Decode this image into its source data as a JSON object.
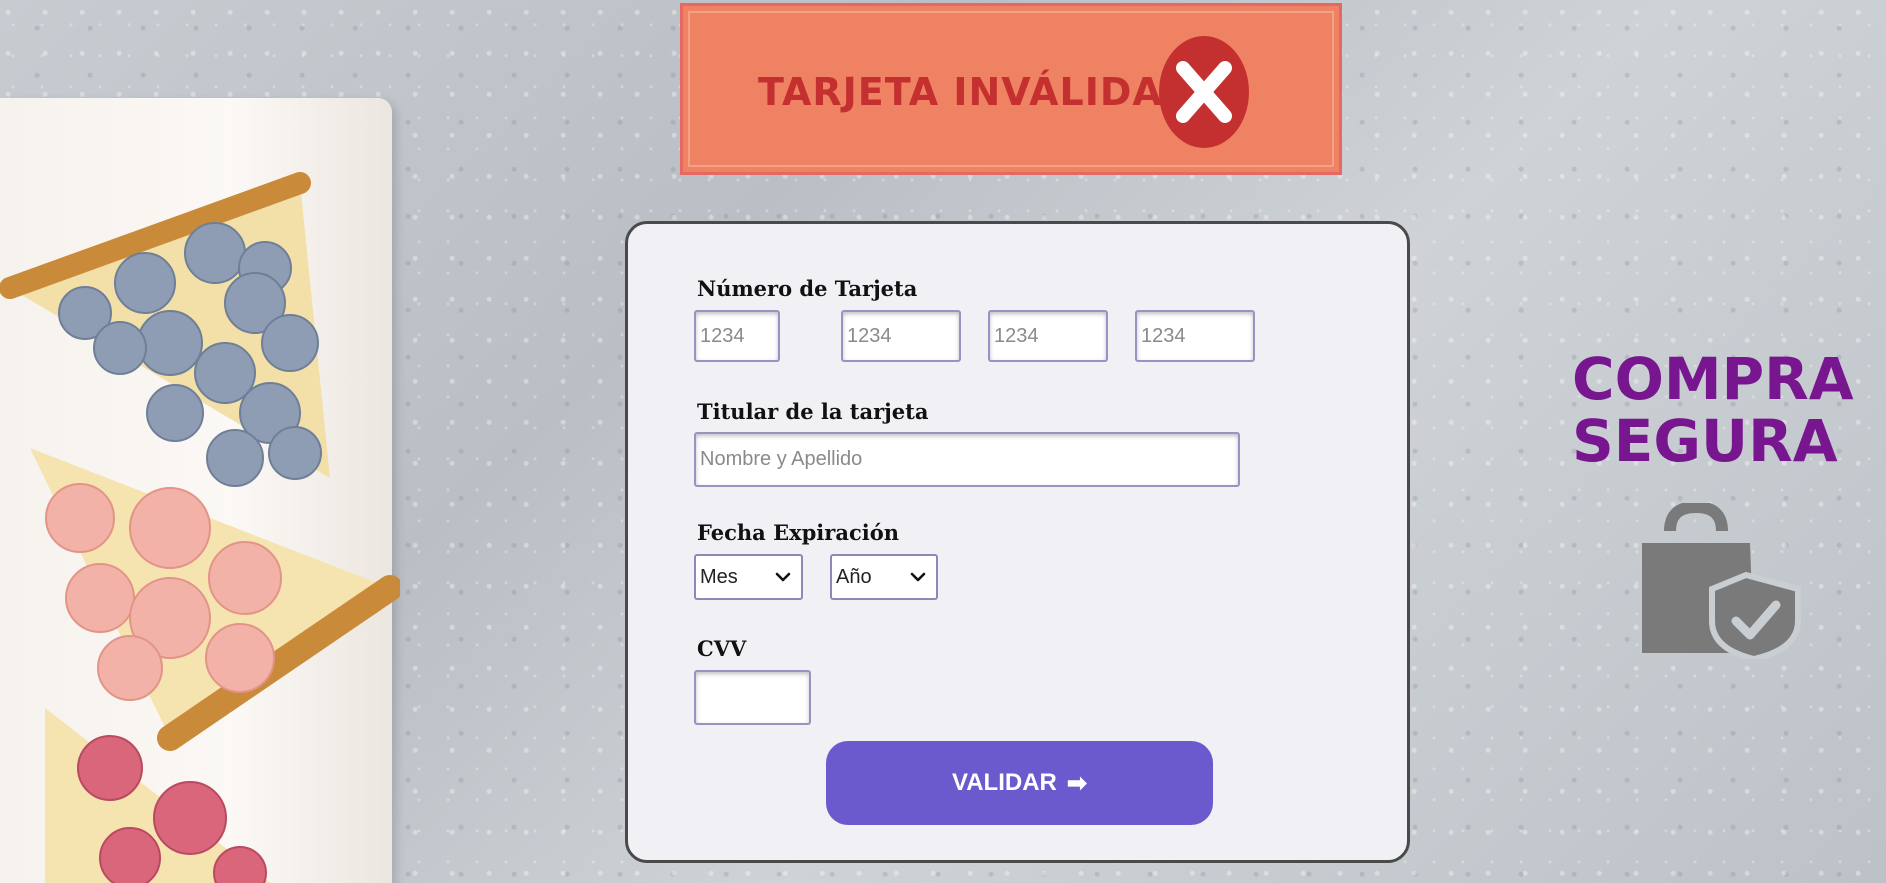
{
  "banner": {
    "text": "TARJETA  INVÁLIDA",
    "icon": "x-circle-icon",
    "color": "#c3302f",
    "background": "#ee8262"
  },
  "form": {
    "card_number": {
      "label": "Número de Tarjeta",
      "fields": [
        {
          "placeholder": "1234"
        },
        {
          "placeholder": "1234"
        },
        {
          "placeholder": "1234"
        },
        {
          "placeholder": "1234"
        }
      ]
    },
    "holder": {
      "label": "Titular de la tarjeta",
      "placeholder": "Nombre y Apellido"
    },
    "expiry": {
      "label": "Fecha Expiración",
      "month": "Mes",
      "year": "Año"
    },
    "cvv": {
      "label": "CVV",
      "value": ""
    },
    "submit": {
      "label": "VALIDAR",
      "arrow": "➡",
      "color": "#6a5acd"
    }
  },
  "badge": {
    "line1": "COMPRA",
    "line2": "SEGURA",
    "icon": "shopping-bag-shield-icon",
    "color": "#78168f"
  }
}
